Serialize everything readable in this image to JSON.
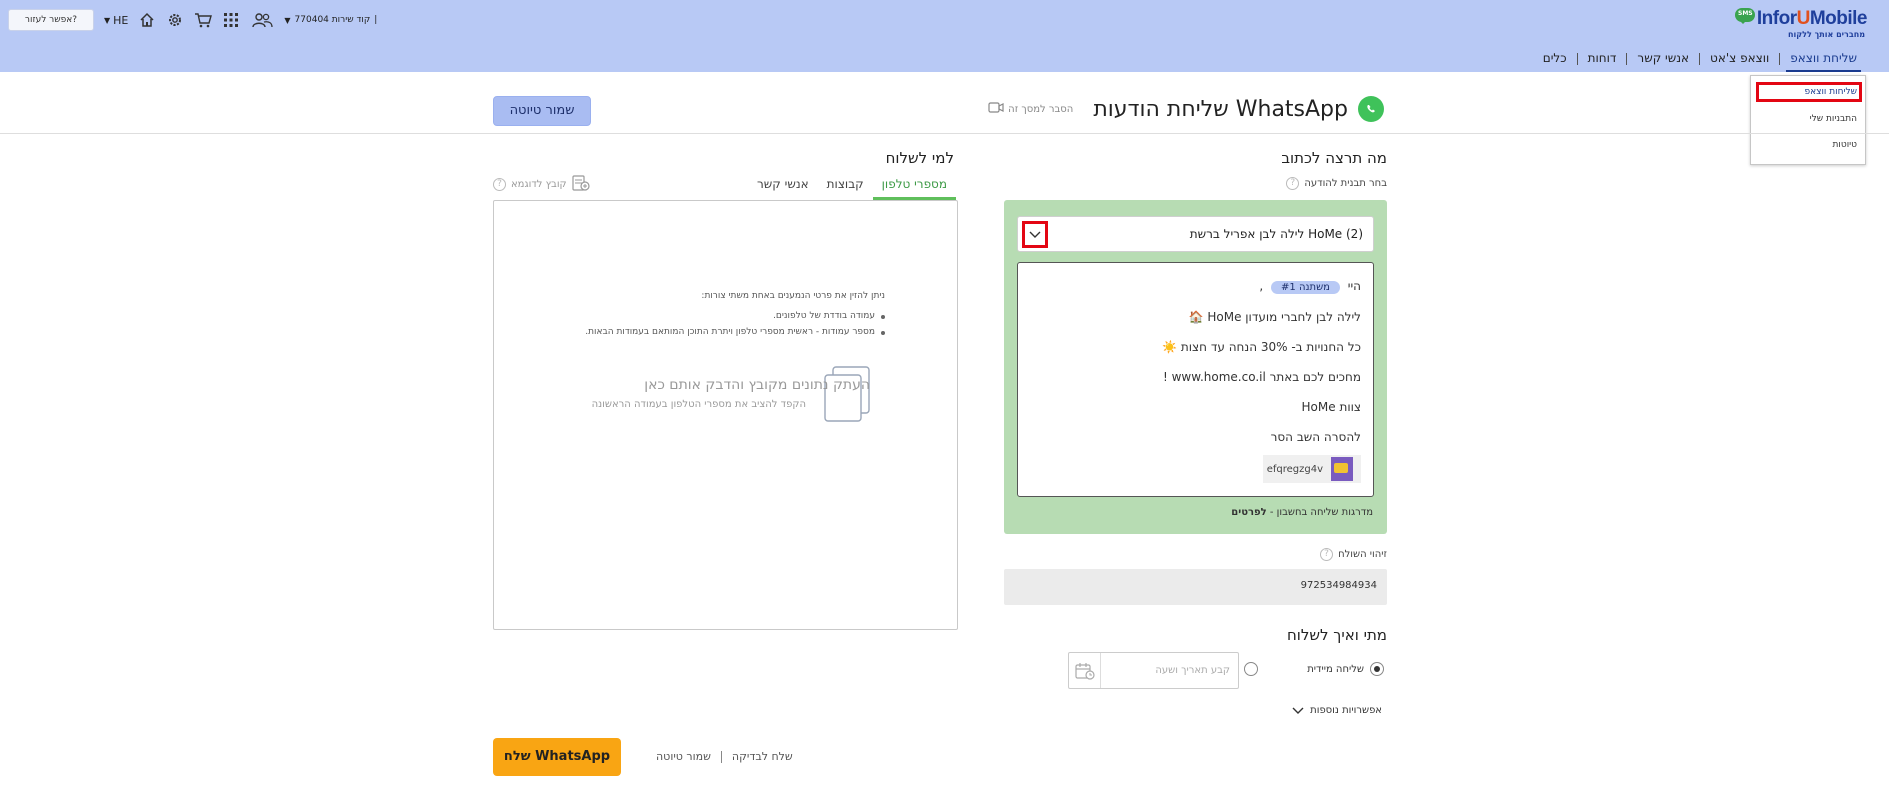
{
  "brand": {
    "name_part1": "Infor",
    "name_u": "U",
    "name_part2": "Mobile",
    "tagline": "מחברים אותך ללקוח",
    "bubble_text": "SMS"
  },
  "topbar": {
    "help_button": "אפשר לעזור?",
    "language": "HE",
    "account_code_label": "קוד שירות 770404",
    "account_sep": "|"
  },
  "nav": {
    "items": [
      {
        "label": "שליחת ווצאפ",
        "active": true
      },
      {
        "label": "ווצאפ צ'אט",
        "active": false
      },
      {
        "label": "אנשי קשר",
        "active": false
      },
      {
        "label": "דוחות",
        "active": false
      },
      {
        "label": "כלים",
        "active": false
      }
    ]
  },
  "dropdown": {
    "items": [
      "שליחות ווצאפ",
      "התבניות שלי",
      "טיוטות"
    ]
  },
  "header": {
    "title": "שליחת הודעות WhatsApp",
    "explain_label": "הסבר למסך זה",
    "save_draft": "שמור טיוטה"
  },
  "compose": {
    "section_title": "מה תרצה לכתוב",
    "template_label": "בחר תבנית להודעה",
    "selected_template": "לילה לבן אפריל ברשת HoMe (2)",
    "message": {
      "greeting": "היי",
      "variable_chip": "משתנה #1",
      "greeting_suffix": ",",
      "line2": "לילה לבן לחברי מועדון HoMe 🏠",
      "line3": "כל החנויות ב- 30% הנחה עד חצות ☀️",
      "line4": "מחכים לכם באתר www.home.co.il !",
      "line5": "צוות HoMe",
      "line6": "להסרה השב הסר",
      "attachment_name": "efqregzg4v"
    },
    "send_levels_text": "מדרגות שליחה בחשבון - ",
    "send_levels_link": "לפרטים"
  },
  "sender": {
    "label": "זיהוי השולח",
    "value": "972534984934"
  },
  "schedule": {
    "section_title": "מתי ואיך לשלוח",
    "immediate_label": "שליחה מיידית",
    "datetime_placeholder": "קבע תאריך ושעה",
    "more_options": "אפשרויות נוספות"
  },
  "recipients": {
    "section_title": "למי לשלוח",
    "tabs": [
      {
        "label": "מספרי טלפון",
        "active": true
      },
      {
        "label": "קבוצות",
        "active": false
      },
      {
        "label": "אנשי קשר",
        "active": false
      }
    ],
    "example_file": "קובץ לדוגמא",
    "instructions_title": "ניתן להזין את פרטי הנמענים באחת משתי צורות:",
    "instructions_bullets": [
      "עמודה בודדת של טלפונים.",
      "מספר עמודות - ראשית מספרי טלפון ויתרת התוכן המותאם בעמודות הבאות."
    ],
    "paste_title": "העתק נתונים מקובץ והדבק אותם כאן",
    "paste_subtitle": "הקפד להציב את מספרי הטלפון בעמודה הראשונה"
  },
  "footer": {
    "send_button": "שלח WhatsApp",
    "save_draft_link": "שמור טיוטה",
    "test_send_link": "שלח לבדיקה"
  },
  "colors": {
    "topbar": "#b8c9f5",
    "green_panel": "#b7dcb3",
    "send_button": "#f9a513",
    "active_tab": "#5fbf5b",
    "highlight": "#e30613"
  }
}
